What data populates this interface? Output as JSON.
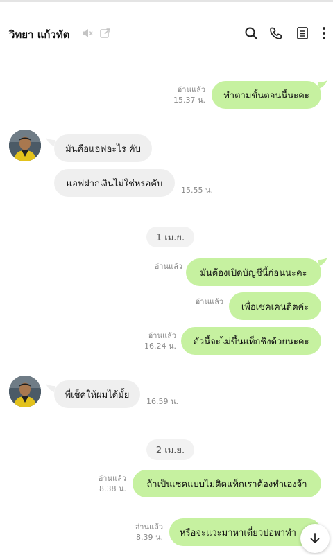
{
  "header": {
    "title": "วิทยา แก้วทัต"
  },
  "messages": [
    {
      "read": "อ่านแล้ว",
      "time": "15.37 น.",
      "text": "ทำตามขั้นตอนนี้นะคะ"
    },
    {
      "text": "มันคือแอฟอะไร คับ"
    },
    {
      "text": "แอฟฝากเงินไม่ใช่หรอคับ",
      "time": "15.55 น."
    },
    {
      "read": "อ่านแล้ว",
      "text": "มันต้องเปิดบัญชีนี้ก่อนนะคะ"
    },
    {
      "read": "อ่านแล้ว",
      "text": "เพื่อเชคเคนดิตค่ะ"
    },
    {
      "read": "อ่านแล้ว",
      "time": "16.24 น.",
      "text": "ตัวนี้จะไม่ขึ้นแท็กชิงด้วยนะคะ"
    },
    {
      "text": "พี่เช็คให้ผมได้มั้ย",
      "time": "16.59 น."
    },
    {
      "read": "อ่านแล้ว",
      "time": "8.38 น.",
      "text": "ถ้าเป็นเชคแบบไม่ติดแท็กเราต้องทำเองจ้า"
    },
    {
      "read": "อ่านแล้ว",
      "time": "8.39 น.",
      "text": "หรือจะแวะมาหาเดี๋ยวปอพาทำ"
    }
  ],
  "dates": [
    "1 เม.ย.",
    "2 เม.ย."
  ],
  "colors": {
    "outgoing_bubble": "#c6f1a0",
    "incoming_bubble": "#efefef",
    "meta_text": "#8a8a8a"
  }
}
